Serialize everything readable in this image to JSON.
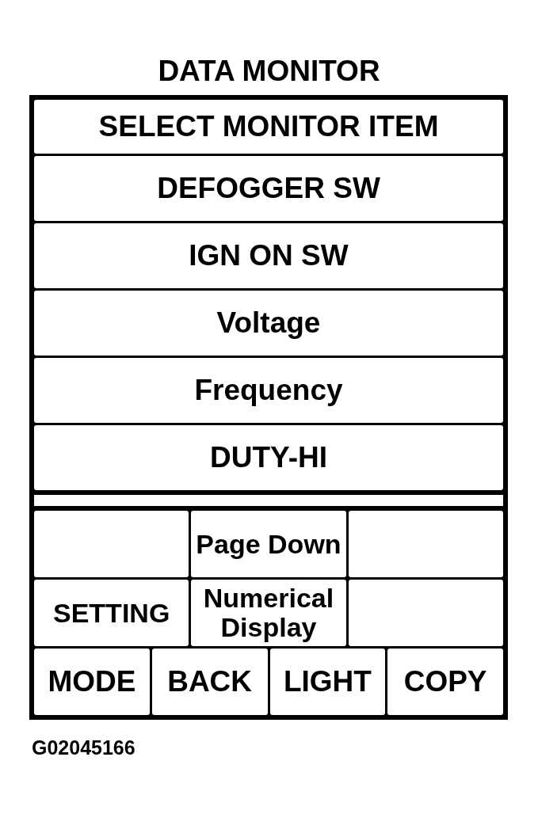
{
  "title": "DATA MONITOR",
  "monitor_panel": {
    "header": "SELECT MONITOR ITEM",
    "items": [
      "DEFOGGER SW",
      "IGN ON SW",
      "Voltage",
      "Frequency",
      "DUTY-HI"
    ]
  },
  "key_rows": [
    {
      "keys": [
        {
          "kind": "blank"
        },
        {
          "kind": "label",
          "label": "Page Down"
        },
        {
          "kind": "blank"
        }
      ]
    },
    {
      "keys": [
        {
          "kind": "label",
          "label": "SETTING"
        },
        {
          "kind": "label",
          "label": "Numerical Display"
        },
        {
          "kind": "blank"
        }
      ]
    }
  ],
  "function_keys": [
    "MODE",
    "BACK",
    "LIGHT",
    "COPY"
  ],
  "figure_code": "G02045166"
}
